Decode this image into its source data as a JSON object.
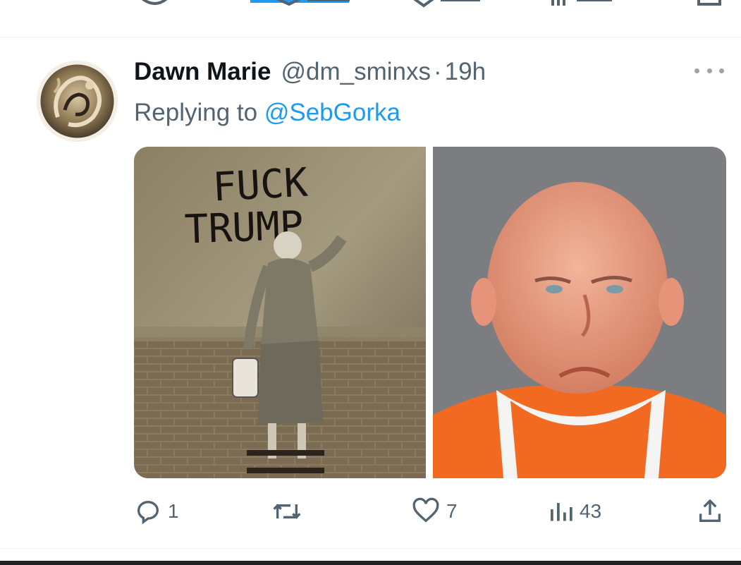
{
  "tweet": {
    "author_name": "Dawn Marie",
    "author_handle": "@dm_sminxs",
    "separator": "·",
    "time": "19h",
    "reply_prefix": "Replying to",
    "reply_mention": "@SebGorka",
    "media": {
      "left_image_text": [
        "FUCK",
        "TRUMP"
      ]
    },
    "actions": {
      "reply_count": "1",
      "retweet_count": "",
      "like_count": "7",
      "view_count": "43"
    }
  },
  "colors": {
    "accent": "#1d9bf0",
    "secondary_text": "#536471",
    "primary_text": "#0f1419"
  },
  "icons": [
    "reply-icon",
    "retweet-icon",
    "like-icon",
    "views-icon",
    "share-icon",
    "more-icon"
  ]
}
